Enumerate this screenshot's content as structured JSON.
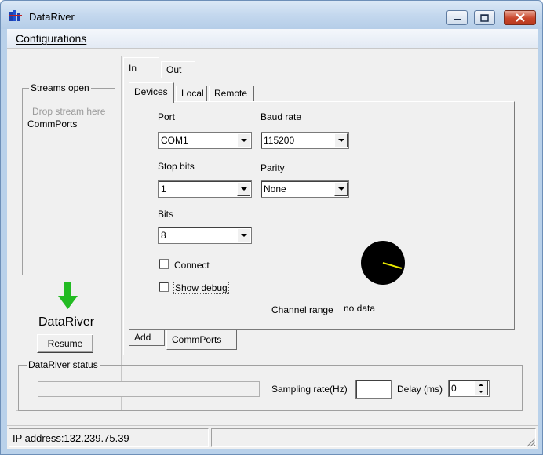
{
  "window": {
    "title": "DataRiver",
    "icon": "datariver-app-icon",
    "controls": [
      "minimize-icon",
      "maximize-icon",
      "close-icon"
    ]
  },
  "menu": {
    "configurations": "Configurations"
  },
  "streams": {
    "group_title": "Streams open",
    "drop_hint": "Drop stream here",
    "items": [
      "CommPorts"
    ]
  },
  "logo": {
    "text": "DataRiver",
    "arrow_color": "#22bb22"
  },
  "resume_button": "Resume",
  "outer_tabs": [
    "In",
    "Out"
  ],
  "inner_tabs": [
    "Devices",
    "Local",
    "Remote"
  ],
  "devices": {
    "port_label": "Port",
    "port_value": "COM1",
    "baud_label": "Baud rate",
    "baud_value": "115200",
    "stopbits_label": "Stop bits",
    "stopbits_value": "1",
    "parity_label": "Parity",
    "parity_value": "None",
    "bits_label": "Bits",
    "bits_value": "8",
    "connect_label": "Connect",
    "show_debug_label": "Show debug",
    "channel_range_label": "Channel range",
    "channel_range_value": "no data",
    "gauge_needle_color": "#e8e800"
  },
  "bottom_tabs": [
    "Add",
    "CommPorts"
  ],
  "status_group": {
    "title": "DataRiver status",
    "sampling_label": "Sampling rate(Hz)",
    "sampling_value": "",
    "delay_label": "Delay (ms)",
    "delay_value": "0"
  },
  "statusbar": {
    "ip": "IP address:132.239.75.39"
  }
}
